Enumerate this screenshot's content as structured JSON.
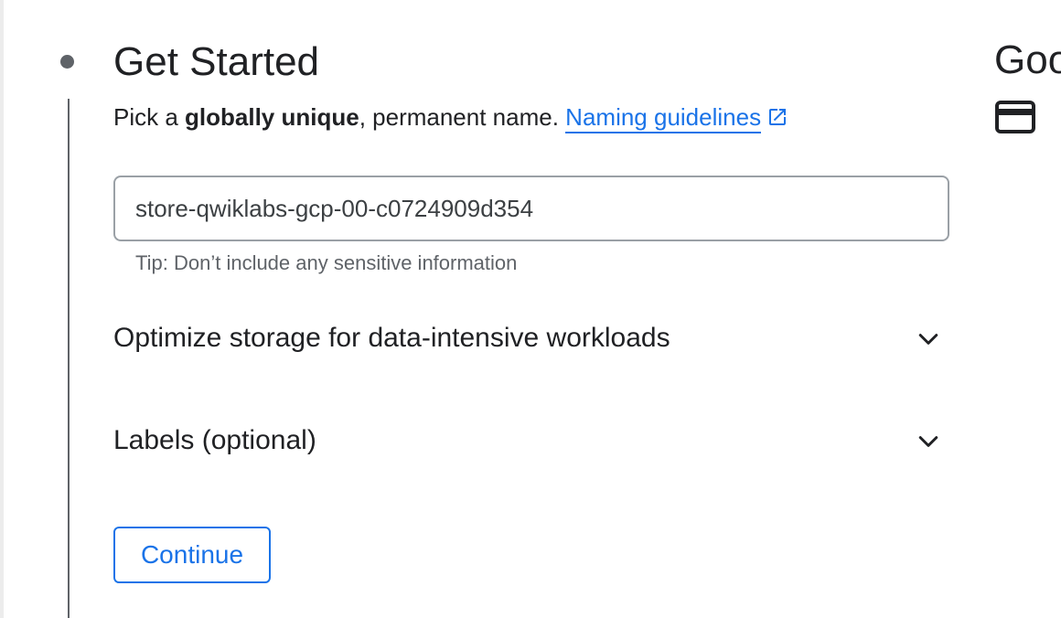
{
  "step": {
    "title": "Get Started",
    "helper_prefix": "Pick a ",
    "helper_bold": "globally unique",
    "helper_suffix": ", permanent name. ",
    "guidelines_link": "Naming guidelines",
    "external_icon": "open-in-new-icon"
  },
  "bucket_name_field": {
    "value": "store-qwiklabs-gcp-00-c0724909d354",
    "tip": "Tip: Don’t include any sensitive information"
  },
  "sections": [
    {
      "label": "Optimize storage for data-intensive workloads",
      "icon": "chevron-down-icon"
    },
    {
      "label": "Labels (optional)",
      "icon": "chevron-down-icon"
    }
  ],
  "actions": {
    "continue_label": "Continue"
  },
  "side_panel": {
    "heading_fragment": "Goo",
    "icon": "credit-card-icon"
  },
  "colors": {
    "accent": "#1a73e8",
    "text": "#202124",
    "muted": "#5f6368",
    "border": "#9aa0a6"
  }
}
